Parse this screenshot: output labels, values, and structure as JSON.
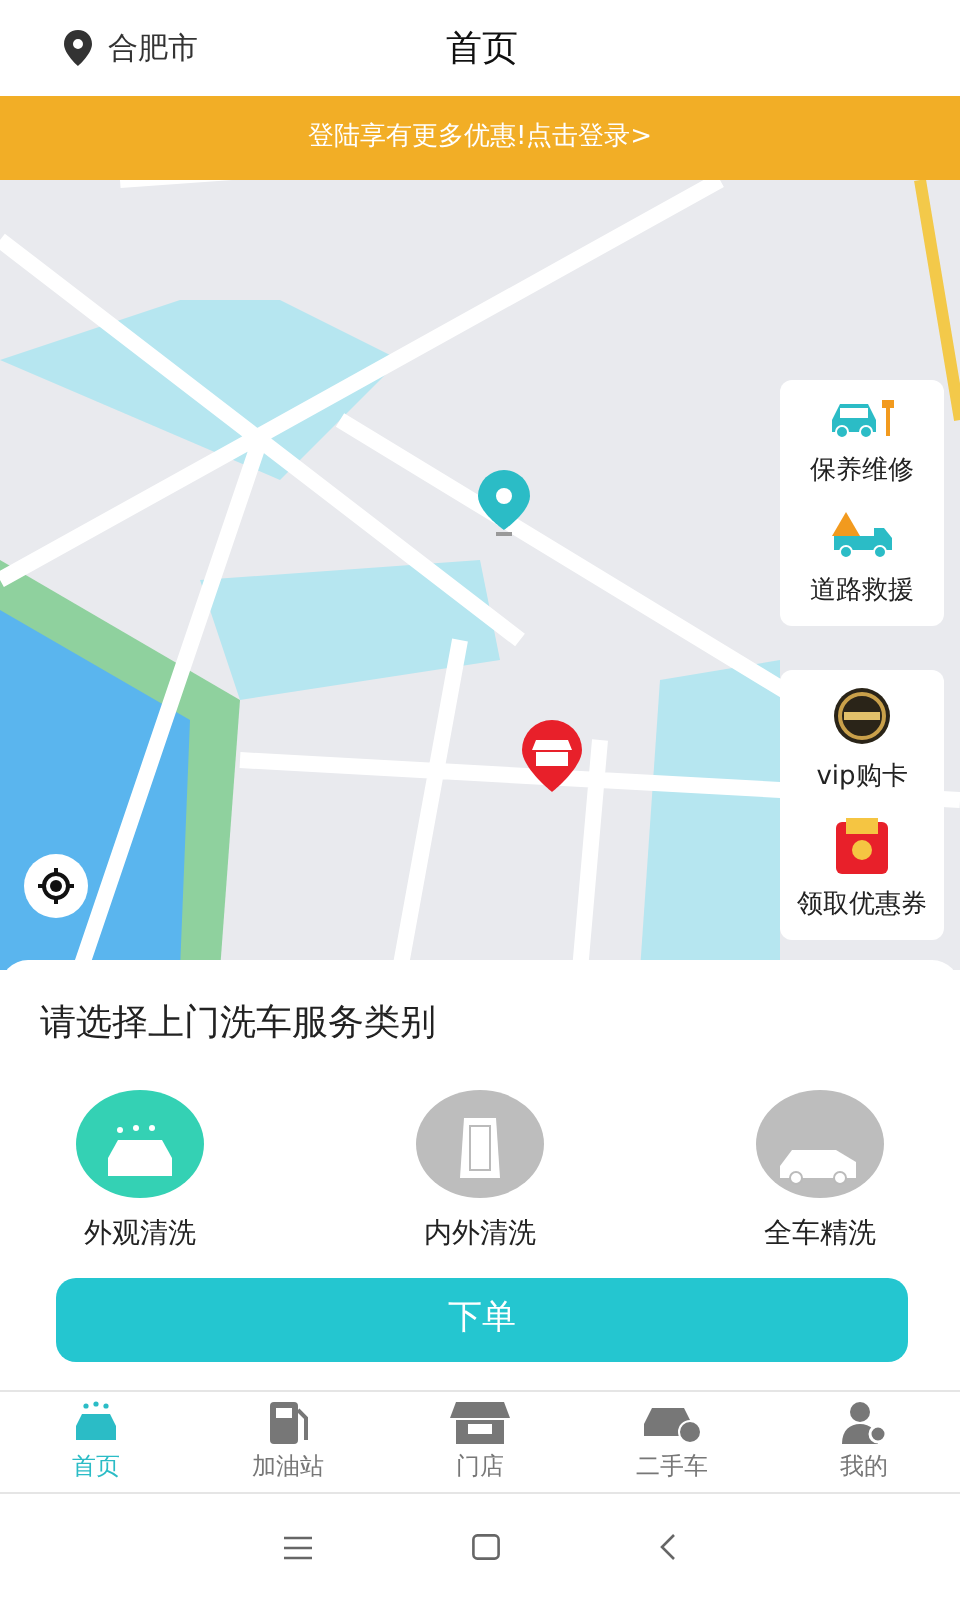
{
  "header": {
    "city": "合肥市",
    "title": "首页"
  },
  "banner": {
    "text": "登陆享有更多优惠!点击登录>"
  },
  "map_shortcuts": [
    {
      "items": [
        {
          "kind": "repair",
          "label": "保养维修"
        },
        {
          "kind": "rescue",
          "label": "道路救援"
        }
      ]
    },
    {
      "items": [
        {
          "kind": "vip",
          "label": "vip购卡"
        },
        {
          "kind": "coupon",
          "label": "领取优惠券"
        }
      ]
    }
  ],
  "service_sheet": {
    "title": "请选择上门洗车服务类别",
    "options": [
      {
        "kind": "exterior",
        "label": "外观清洗",
        "selected": true
      },
      {
        "kind": "interior",
        "label": "内外清洗",
        "selected": false
      },
      {
        "kind": "full",
        "label": "全车精洗",
        "selected": false
      }
    ],
    "button": "下单"
  },
  "tab_bar": [
    {
      "kind": "home",
      "label": "首页",
      "selected": true
    },
    {
      "kind": "fuel",
      "label": "加油站",
      "selected": false
    },
    {
      "kind": "store",
      "label": "门店",
      "selected": false
    },
    {
      "kind": "usedcar",
      "label": "二手车",
      "selected": false
    },
    {
      "kind": "me",
      "label": "我的",
      "selected": false
    }
  ]
}
